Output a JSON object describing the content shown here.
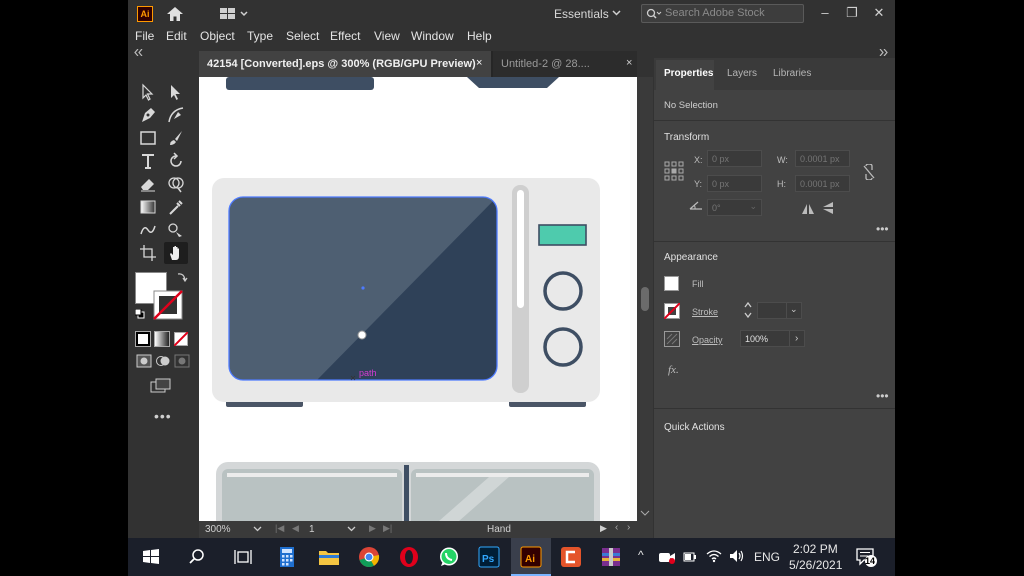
{
  "app": {
    "logo_text": "Ai",
    "workspace": "Essentials",
    "search_placeholder": "Search Adobe Stock",
    "accent_color": "#ff9a00"
  },
  "menu": [
    "File",
    "Edit",
    "Object",
    "Type",
    "Select",
    "Effect",
    "View",
    "Window",
    "Help"
  ],
  "tabs": [
    {
      "label": "42154 [Converted].eps @ 300% (RGB/GPU Preview)",
      "close": "×"
    },
    {
      "label": "Untitled-2 @ 28....",
      "close": "×"
    }
  ],
  "canvas": {
    "path_label": "path",
    "colors": {
      "screen_dark": "#2f4158",
      "screen_light": "#4e5f72",
      "display": "#4ecbad",
      "body": "#e9e9e9",
      "feet": "#4a5566"
    }
  },
  "status": {
    "zoom": "300%",
    "artboard": "1",
    "tool": "Hand"
  },
  "properties": {
    "tabs": [
      "Properties",
      "Layers",
      "Libraries"
    ],
    "selection": "No Selection",
    "transform": {
      "title": "Transform",
      "x_label": "X:",
      "x_value": "0 px",
      "y_label": "Y:",
      "y_value": "0 px",
      "w_label": "W:",
      "w_value": "0.0001 px",
      "h_label": "H:",
      "h_value": "0.0001 px",
      "angle_value": "0°"
    },
    "appearance": {
      "title": "Appearance",
      "fill": "Fill",
      "stroke": "Stroke",
      "opacity": "Opacity",
      "opacity_value": "100%",
      "fx": "fx."
    },
    "quick_actions": "Quick Actions"
  },
  "taskbar": {
    "language": "ENG",
    "time": "2:02 PM",
    "date": "5/26/2021",
    "notifications": "14"
  }
}
